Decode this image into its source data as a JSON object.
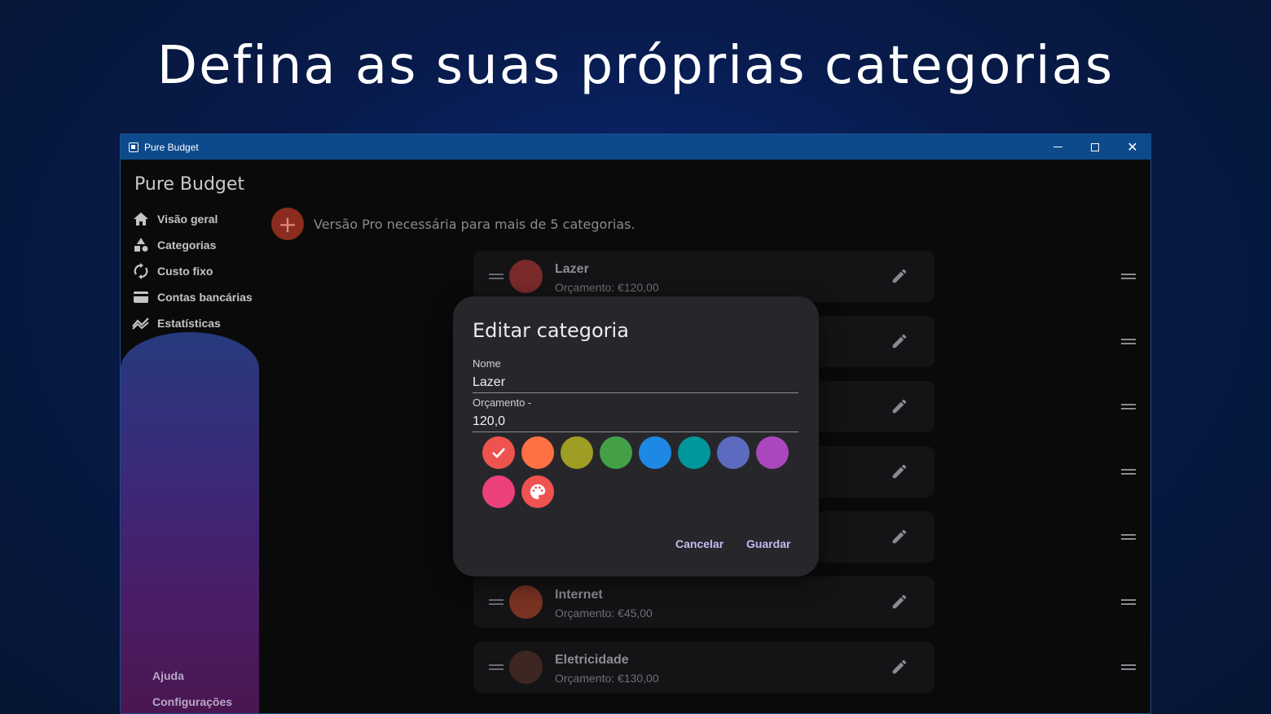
{
  "headline": "Defina as suas próprias categorias",
  "window": {
    "title": "Pure Budget"
  },
  "sidebar": {
    "app_name": "Pure Budget",
    "items": [
      {
        "label": "Visão geral",
        "icon": "home-icon"
      },
      {
        "label": "Categorias",
        "icon": "shapes-icon"
      },
      {
        "label": "Custo fixo",
        "icon": "refresh-icon"
      },
      {
        "label": "Contas bancárias",
        "icon": "card-icon"
      },
      {
        "label": "Estatísticas",
        "icon": "chart-icon"
      }
    ],
    "bottom": [
      "Ajuda",
      "Configurações"
    ]
  },
  "pro_notice": "Versão Pro necessária para mais de 5 categorias.",
  "categories": [
    {
      "name": "Lazer",
      "budget": "Orçamento: €120,00",
      "color": "#7a2a2a"
    },
    {
      "name": "Internet",
      "budget": "Orçamento: €45,00",
      "color": "#7a3322"
    },
    {
      "name": "Eletricidade",
      "budget": "Orçamento: €130,00",
      "color": "#3e2622"
    }
  ],
  "dialog": {
    "title": "Editar categoria",
    "name_label": "Nome",
    "name_value": "Lazer",
    "budget_label": "Orçamento -",
    "budget_value": "120,0",
    "colors": [
      "#ef5350",
      "#ff7043",
      "#9e9d24",
      "#43a047",
      "#1e88e5",
      "#00979b",
      "#5c6bc0",
      "#ab47bc",
      "#ec407a"
    ],
    "selected_color": "#ef5350",
    "custom_color": "#ef5350",
    "cancel": "Cancelar",
    "save": "Guardar"
  }
}
